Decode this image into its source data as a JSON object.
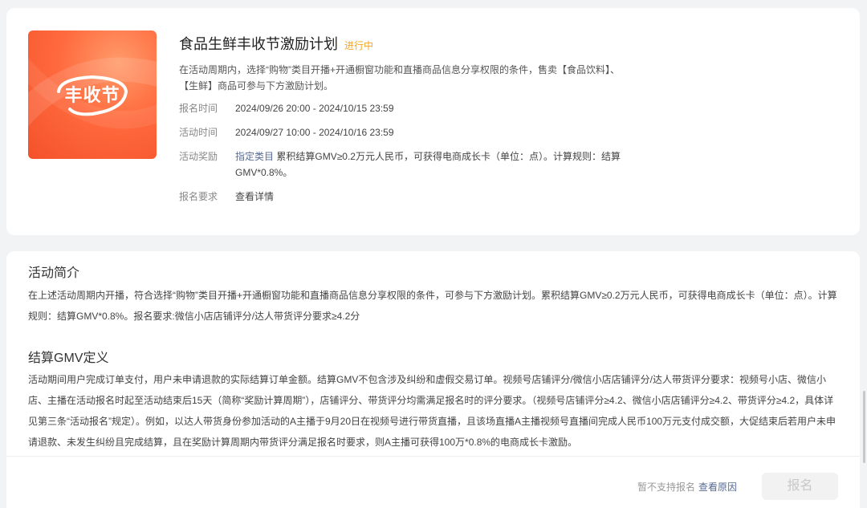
{
  "activity": {
    "banner_text": "丰收节",
    "title": "食品生鲜丰收节激励计划",
    "status": "进行中",
    "description": "在活动周期内，选择“购物”类目开播+开通橱窗功能和直播商品信息分享权限的条件，售卖【食品饮料】、【生鲜】商品可参与下方激励计划。",
    "signup_time_label": "报名时间",
    "signup_time": "2024/09/26 20:00 - 2024/10/15 23:59",
    "activity_time_label": "活动时间",
    "activity_time": "2024/09/27 10:00 - 2024/10/16 23:59",
    "reward_label": "活动奖励",
    "reward_link": "指定类目",
    "reward_text": "累积结算GMV≥0.2万元人民币，可获得电商成长卡（单位：点）。计算规则：结算GMV*0.8%。",
    "requirement_label": "报名要求",
    "requirement_link": "查看详情"
  },
  "intro": {
    "heading": "活动简介",
    "text": "在上述活动周期内开播，符合选择“购物”类目开播+开通橱窗功能和直播商品信息分享权限的条件，可参与下方激励计划。累积结算GMV≥0.2万元人民币，可获得电商成长卡（单位：点）。计算规则：结算GMV*0.8%。报名要求:微信小店店铺评分/达人带货评分要求≥4.2分"
  },
  "gmv": {
    "heading": "结算GMV定义",
    "text": "活动期间用户完成订单支付，用户未申请退款的实际结算订单金额。结算GMV不包含涉及纠纷和虚假交易订单。视频号店铺评分/微信小店店铺评分/达人带货评分要求：视频号小店、微信小店、主播在活动报名时起至活动结束后15天（简称“奖励计算周期”），店铺评分、带货评分均需满足报名时的评分要求。（视频号店铺评分≥4.2、微信小店店铺评分≥4.2、带货评分≥4.2，具体详见第三条“活动报名”规定）。例如，以达人带货身份参加活动的A主播于9月20日在视频号进行带货直播，且该场直播A主播视频号直播间完成人民币100万元支付成交额，大促结束后若用户未申请退款、未发生纠纷且完成结算，且在奖励计算周期内带货评分满足报名时要求，则A主播可获得100万*0.8%的电商成长卡激励。"
  },
  "footer": {
    "note": "暂不支持报名",
    "note_link": "查看原因",
    "button": "报名"
  },
  "colors": {
    "accent_link": "#576b95",
    "status": "#f5a623",
    "banner": "#f4512a"
  }
}
